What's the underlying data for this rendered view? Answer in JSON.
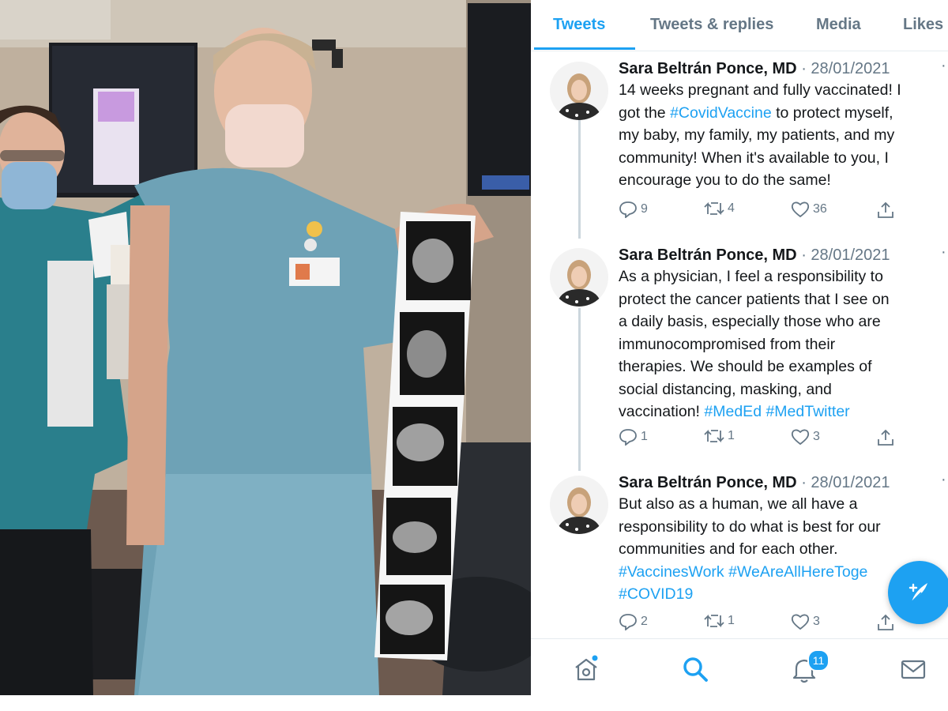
{
  "tabs": [
    {
      "label": "Tweets"
    },
    {
      "label": "Tweets & replies"
    },
    {
      "label": "Media"
    },
    {
      "label": "Likes"
    }
  ],
  "tweets": [
    {
      "author": "Sara Beltrán Ponce, MD",
      "date": "· 28/01/2021",
      "lines": [
        "14 weeks pregnant and fully vaccinated! I",
        [
          "got the ",
          "#CovidVaccine",
          " to protect myself,"
        ],
        "my baby, my family, my patients, and my",
        "community! When it's available to you, I",
        "encourage you to do the same!"
      ],
      "replies": "9",
      "retweets": "4",
      "likes": "36"
    },
    {
      "author": "Sara Beltrán Ponce, MD",
      "date": "· 28/01/2021",
      "lines": [
        "As a physician, I feel a responsibility to",
        "protect the cancer patients that I see on",
        "a daily basis, especially those who are",
        "immunocompromised from their",
        "therapies. We should be examples of",
        "social distancing, masking, and",
        [
          "vaccination! ",
          "#MedEd #MedTwitter",
          ""
        ]
      ],
      "replies": "1",
      "retweets": "1",
      "likes": "3"
    },
    {
      "author": "Sara Beltrán Ponce, MD",
      "date": "· 28/01/2021",
      "lines": [
        "But also as a human, we all have a",
        "responsibility to do what is best for our",
        "communities and for each other.",
        [
          "",
          "#VaccinesWork #WeAreAllHereToge",
          ""
        ],
        [
          "",
          "#COVID19",
          ""
        ]
      ],
      "replies": "2",
      "retweets": "1",
      "likes": "3"
    }
  ],
  "more_glyph": "···",
  "notifications_badge": "11",
  "colors": {
    "accent": "#1da1f2",
    "text": "#14171a",
    "muted": "#657786"
  },
  "icons": [
    "reply-icon",
    "retweet-icon",
    "like-icon",
    "share-icon",
    "compose-icon",
    "home-icon",
    "search-icon",
    "bell-icon",
    "mail-icon"
  ]
}
